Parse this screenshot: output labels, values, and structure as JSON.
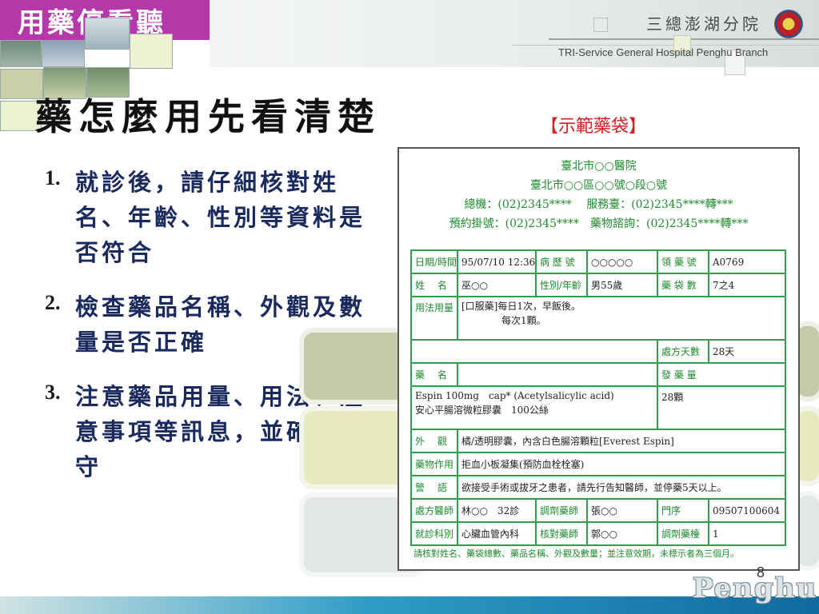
{
  "header": {
    "section_title": "用藥停看聽",
    "hospital_cn": "三總澎湖分院",
    "hospital_en": "TRI-Service General Hospital Penghu Branch"
  },
  "heading": "藥怎麼用先看清楚",
  "steps": [
    {
      "num": "1.",
      "text": "就診後，請仔細核對姓名、年齡、性別等資料是否符合"
    },
    {
      "num": "2.",
      "text": "檢查藥品名稱、外觀及數量是否正確"
    },
    {
      "num": "3.",
      "text": "注意藥品用量、用法、注意事項等訊息，並確實遵守"
    }
  ],
  "caption": "【示範藥袋】",
  "bag": {
    "hospital": "臺北市○○醫院",
    "address": "臺北市○○區○○號○段○號",
    "phone_line": "總機：(02)2345****　 服務臺：(02)2345****轉***",
    "appt_line": "預約掛號：(02)2345****　藥物諮詢：(02)2345****轉***",
    "date_label": "日期/時間",
    "date_value": "95/07/10 12:36",
    "record_label": "病 歷 號",
    "record_value": "○○○○○",
    "claim_label": "領 藥 號",
    "claim_value": "A0769",
    "name_label": "姓　 名",
    "name_value": "巫○○",
    "sexage_label": "性別/年齡",
    "sexage_value": "男55歲",
    "bags_label": "藥 袋 數",
    "bags_value": "7之4",
    "usage_label": "用法用量",
    "usage_line1": "[口服藥]每日1次，早飯後。",
    "usage_line2": "每次1顆。",
    "days_label": "處方天數",
    "days_value": "28天",
    "drug_label": "藥　 名",
    "qty_label": "發 藥 量",
    "drug_line1": "Espin 100mg　cap* (Acetylsalicylic acid)",
    "drug_line2": "安心平腸溶微粒膠囊　100公絲",
    "qty_value": "28顆",
    "appearance_label": "外　 觀",
    "appearance_value": "橘/透明膠囊，內含白色腸溶顆粒[Everest Espin]",
    "effect_label": "藥物作用",
    "effect_value": "拒血小板凝集(預防血栓栓塞)",
    "warning_label": "警　 語",
    "warning_value": "欲接受手術或拔牙之患者，請先行告知醫師，並停藥5天以上。",
    "doctor_label": "處方醫師",
    "doctor_value": "林○○　32診",
    "pharmacist_label": "調劑藥師",
    "pharmacist_value": "張○○",
    "seq_label": "門序",
    "seq_value": "09507100604",
    "dept_label": "就診科別",
    "dept_value": "心臟血管內科",
    "checker_label": "核對藥師",
    "checker_value": "郭○○",
    "counter_label": "調劑藥檯",
    "counter_value": "1",
    "note": "請核對姓名、藥袋總數、藥品名稱、外觀及數量；並注意效期，未標示者為三個月。"
  },
  "footer": {
    "page_number": "8",
    "logo_text": "Penghu"
  },
  "colors": {
    "title_bar": "#b538a8",
    "heading_text": "#111111",
    "step_text": "#1a2a5e",
    "caption_red": "#d42020",
    "bag_green": "#2fa04a"
  }
}
